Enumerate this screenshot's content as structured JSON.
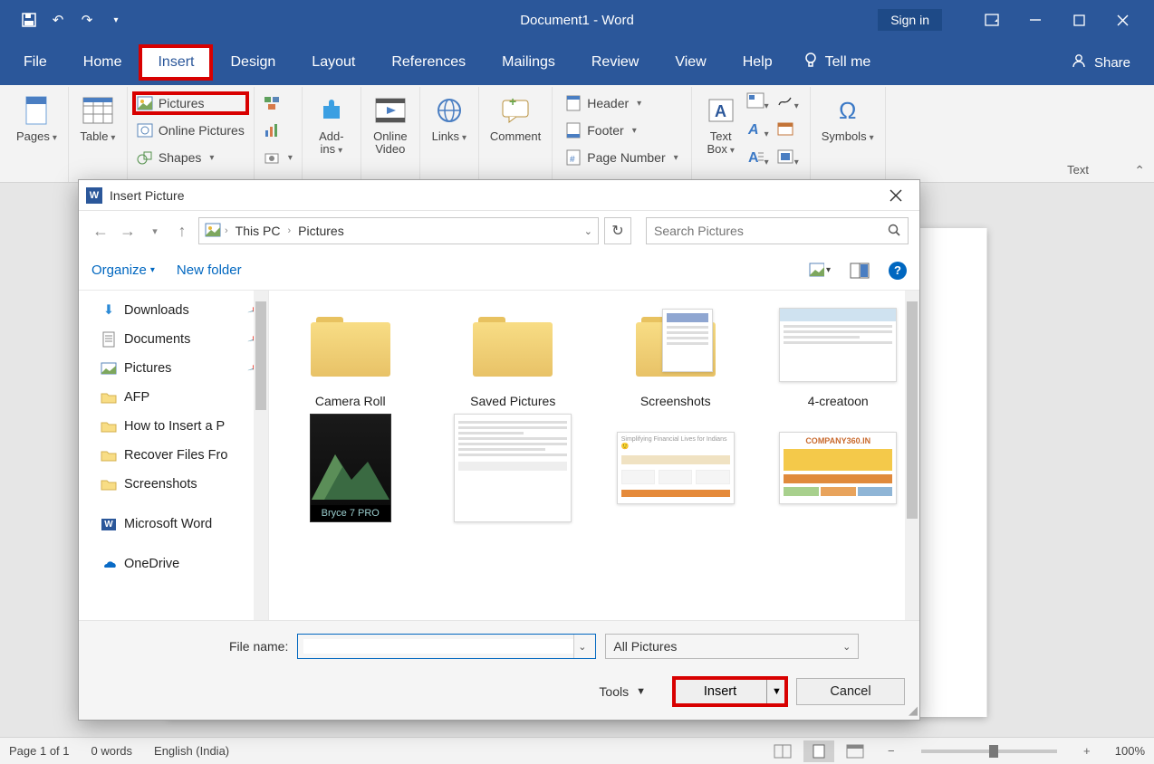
{
  "titlebar": {
    "title": "Document1  -  Word",
    "signin": "Sign in"
  },
  "tabs": {
    "file": "File",
    "home": "Home",
    "insert": "Insert",
    "design": "Design",
    "layout": "Layout",
    "references": "References",
    "mailings": "Mailings",
    "review": "Review",
    "view": "View",
    "help": "Help",
    "tellme": "Tell me",
    "share": "Share"
  },
  "ribbon": {
    "pages": "Pages",
    "table": "Table",
    "pictures": "Pictures",
    "online_pictures": "Online Pictures",
    "shapes": "Shapes",
    "addins": "Add-\nins",
    "online_video": "Online\nVideo",
    "links": "Links",
    "comment": "Comment",
    "header": "Header",
    "footer": "Footer",
    "page_number": "Page Number",
    "text_box": "Text\nBox",
    "symbols": "Symbols",
    "text_group": "Text"
  },
  "dialog": {
    "title": "Insert Picture",
    "path": {
      "root_icon": "🖼",
      "seg1": "This PC",
      "seg2": "Pictures"
    },
    "search_placeholder": "Search Pictures",
    "organize": "Organize",
    "new_folder": "New folder",
    "tree": {
      "downloads": "Downloads",
      "documents": "Documents",
      "pictures": "Pictures",
      "afp": "AFP",
      "how_to": "How to Insert a P",
      "recover": "Recover Files Fro",
      "screenshots": "Screenshots",
      "msword": "Microsoft Word",
      "onedrive": "OneDrive"
    },
    "files": {
      "camera_roll": "Camera Roll",
      "saved_pictures": "Saved Pictures",
      "screenshots": "Screenshots",
      "creatoon": "4-creatoon",
      "bryce_caption": "Bryce 7 PRO",
      "company_caption": "COMPANY360.IN"
    },
    "file_name_label": "File name:",
    "filter": "All Pictures",
    "tools": "Tools",
    "insert": "Insert",
    "cancel": "Cancel"
  },
  "status": {
    "page": "Page 1 of 1",
    "words": "0 words",
    "lang": "English (India)",
    "zoom": "100%"
  }
}
